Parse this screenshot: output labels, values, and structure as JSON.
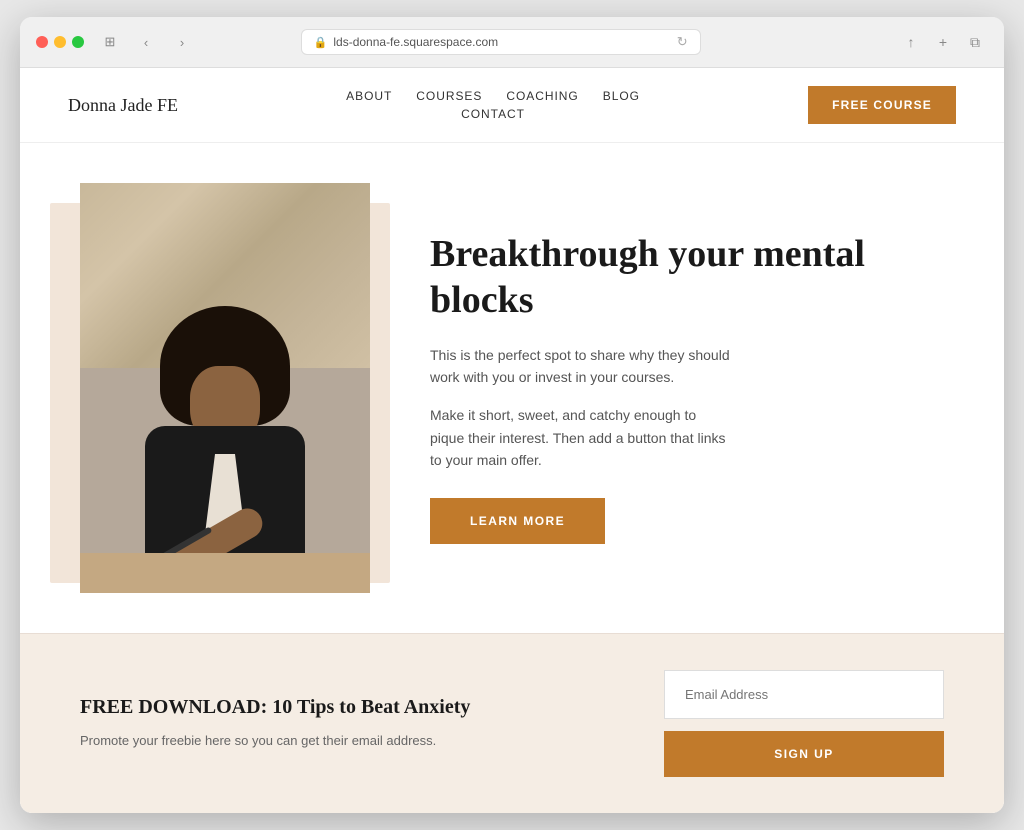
{
  "browser": {
    "url": "lds-donna-fe.squarespace.com",
    "back_icon": "‹",
    "forward_icon": "›",
    "reload_icon": "↻",
    "share_icon": "↑",
    "add_tab_icon": "+",
    "tabs_icon": "⧉"
  },
  "header": {
    "logo": "Donna Jade FE",
    "nav": {
      "about": "ABOUT",
      "courses": "COURSES",
      "coaching": "COACHING",
      "blog": "BLOG",
      "contact": "CONTACT"
    },
    "cta_button": "FREE COURSE"
  },
  "hero": {
    "title": "Breakthrough your mental blocks",
    "description1": "This is the perfect spot to share why they should work with you or invest in your courses.",
    "description2": "Make it short, sweet, and catchy enough to pique their interest. Then add a button that links to your main offer.",
    "cta_button": "LEARN MORE"
  },
  "free_download": {
    "title": "FREE DOWNLOAD: 10 Tips to Beat Anxiety",
    "description": "Promote your freebie here so you can get their email address.",
    "email_placeholder": "Email Address",
    "signup_button": "SIGN UP"
  },
  "colors": {
    "accent": "#c17a2b",
    "bg_light": "#f5ede4",
    "hero_bg": "#f2e5d9"
  }
}
